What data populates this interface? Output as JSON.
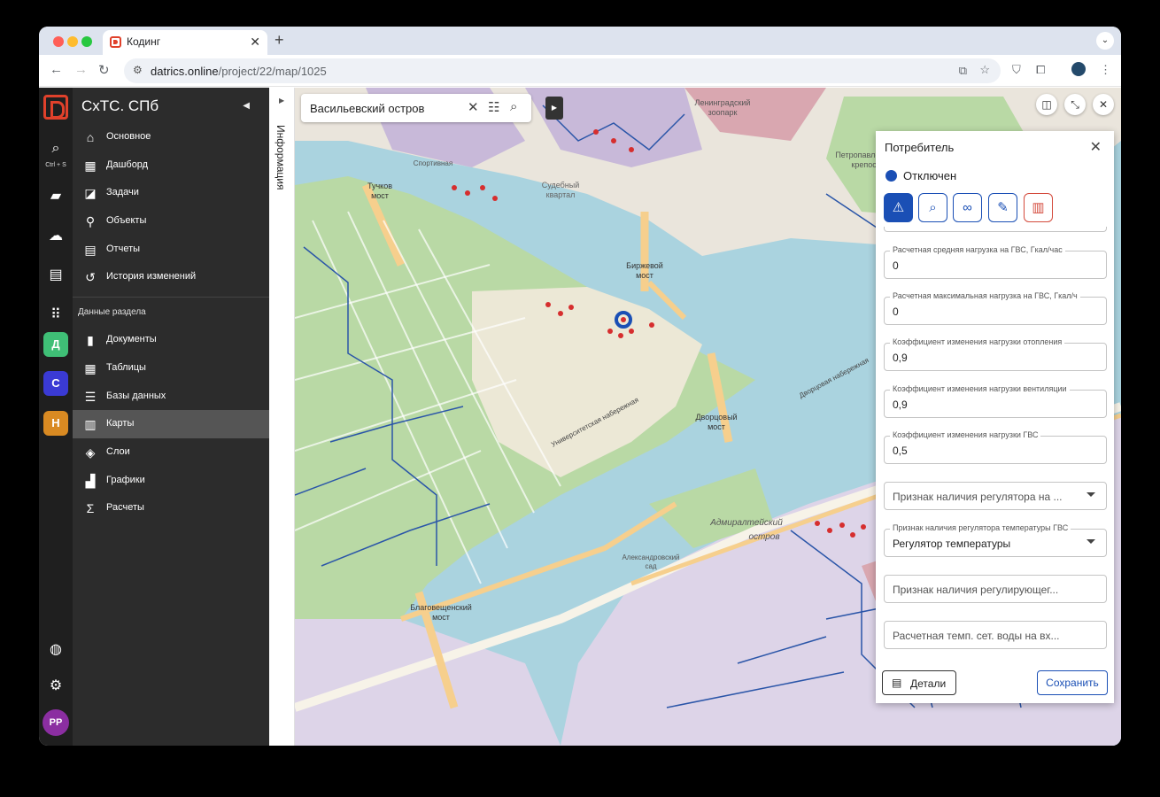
{
  "browser": {
    "tab_title": "Кодинг",
    "url_host": "datrics.online",
    "url_path": "/project/22/map/1025"
  },
  "rail": {
    "save_shortcut": "Ctrl + S",
    "chips": [
      "Д",
      "C",
      "Н"
    ],
    "chip_colors": [
      "#3fbf76",
      "#3a3ad4",
      "#d98a22"
    ],
    "avatar": "PP"
  },
  "sidebar": {
    "title": "СхТС. СПб",
    "items": [
      {
        "label": "Основное",
        "icon": "home-icon"
      },
      {
        "label": "Дашборд",
        "icon": "dashboard-icon"
      },
      {
        "label": "Задачи",
        "icon": "tasks-icon"
      },
      {
        "label": "Объекты",
        "icon": "pin-icon"
      },
      {
        "label": "Отчеты",
        "icon": "report-icon"
      },
      {
        "label": "История изменений",
        "icon": "history-icon"
      }
    ],
    "section_title": "Данные раздела",
    "data_items": [
      {
        "label": "Документы",
        "icon": "book-icon"
      },
      {
        "label": "Таблицы",
        "icon": "table-icon"
      },
      {
        "label": "Базы данных",
        "icon": "database-icon"
      },
      {
        "label": "Карты",
        "icon": "map-icon",
        "active": true
      },
      {
        "label": "Слои",
        "icon": "layers-icon"
      },
      {
        "label": "Графики",
        "icon": "chart-icon"
      },
      {
        "label": "Расчеты",
        "icon": "sigma-icon"
      }
    ]
  },
  "info_strip": {
    "label": "Информация"
  },
  "map": {
    "search_value": "Васильевский остров",
    "labels": [
      {
        "text": "Биржевой"
      },
      {
        "text": "мост"
      },
      {
        "text": "Дворцовый"
      },
      {
        "text": "мост"
      },
      {
        "text": "Благовещенский"
      },
      {
        "text": "мост"
      },
      {
        "text": "Тучков"
      },
      {
        "text": "мост"
      },
      {
        "text": "Адмиралтейский"
      },
      {
        "text": "остров"
      },
      {
        "text": "Судебный"
      },
      {
        "text": "квартал"
      },
      {
        "text": "Ленинградский"
      },
      {
        "text": "зоопарк"
      },
      {
        "text": "Петропавловская"
      },
      {
        "text": "крепость"
      },
      {
        "text": "Университетская набережная"
      },
      {
        "text": "Дворцовая набережная"
      },
      {
        "text": "Александровский"
      },
      {
        "text": "сад"
      },
      {
        "text": "Спортивная"
      }
    ]
  },
  "panel": {
    "title": "Потребитель",
    "status": "Отключен",
    "fields": [
      {
        "label": "Расчетная средняя нагрузка на ГВС, Гкал/час",
        "value": "0"
      },
      {
        "label": "Расчетная максимальная нагрузка на ГВС, Гкал/ч",
        "value": "0"
      },
      {
        "label": "Коэффициент изменения нагрузки отопления",
        "value": "0,9"
      },
      {
        "label": "Коэффициент изменения нагрузки вентиляции",
        "value": "0,9"
      },
      {
        "label": "Коэффициент изменения нагрузки ГВС",
        "value": "0,5"
      }
    ],
    "select_regulator_placeholder": "Признак наличия регулятора на ...",
    "select_temp_label": "Признак наличия регулятора температуры ГВС",
    "select_temp_value": "Регулятор температуры",
    "field_regulating_placeholder": "Признак наличия регулирующег...",
    "field_temp_placeholder": "Расчетная темп. сет. воды на вх...",
    "details_label": "Детали",
    "save_label": "Сохранить"
  }
}
